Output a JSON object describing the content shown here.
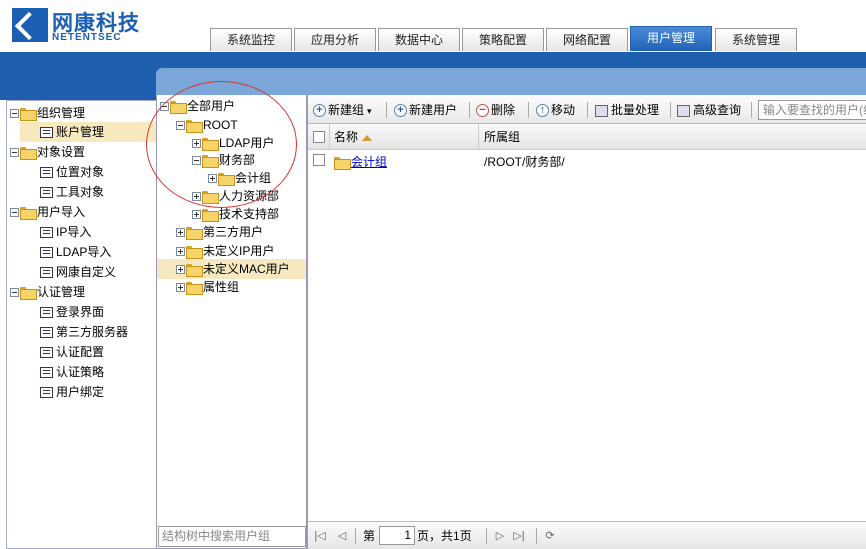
{
  "brand": {
    "name_cn": "网康科技",
    "name_en": "NETENTSEC"
  },
  "tabs": [
    {
      "label": "系统监控"
    },
    {
      "label": "应用分析"
    },
    {
      "label": "数据中心"
    },
    {
      "label": "策略配置"
    },
    {
      "label": "网络配置"
    },
    {
      "label": "用户管理",
      "active": true
    },
    {
      "label": "系统管理"
    }
  ],
  "leftnav": {
    "groups": [
      {
        "label": "组织管理",
        "items": [
          {
            "label": "账户管理",
            "selected": true
          }
        ]
      },
      {
        "label": "对象设置",
        "items": [
          {
            "label": "位置对象"
          },
          {
            "label": "工具对象"
          }
        ]
      },
      {
        "label": "用户导入",
        "items": [
          {
            "label": "IP导入"
          },
          {
            "label": "LDAP导入"
          },
          {
            "label": "网康自定义"
          }
        ]
      },
      {
        "label": "认证管理",
        "items": [
          {
            "label": "登录界面"
          },
          {
            "label": "第三方服务器"
          },
          {
            "label": "认证配置"
          },
          {
            "label": "认证策略"
          },
          {
            "label": "用户绑定"
          }
        ]
      }
    ]
  },
  "tree": {
    "nodes": [
      {
        "label": "全部用户"
      },
      {
        "label": "ROOT"
      },
      {
        "label": "LDAP用户"
      },
      {
        "label": "财务部"
      },
      {
        "label": "会计组"
      },
      {
        "label": "人力资源部"
      },
      {
        "label": "技术支持部"
      },
      {
        "label": "第三方用户"
      },
      {
        "label": "未定义IP用户"
      },
      {
        "label": "未定义MAC用户"
      },
      {
        "label": "属性组"
      }
    ],
    "search_placeholder": "结构树中搜索用户组"
  },
  "toolbar": {
    "new_group": "新建组",
    "new_user": "新建用户",
    "delete": "删除",
    "move": "移动",
    "batch": "批量处理",
    "advanced_search": "高级查询",
    "search_placeholder": "输入要查找的用户(组"
  },
  "grid": {
    "columns": [
      "名称",
      "所属组"
    ],
    "rows": [
      {
        "name": "会计组",
        "group": "/ROOT/财务部/"
      }
    ]
  },
  "pager": {
    "page_prefix": "第",
    "page_value": "1",
    "page_suffix": "页，共",
    "total_pages": "1",
    "total_suffix": "页"
  }
}
